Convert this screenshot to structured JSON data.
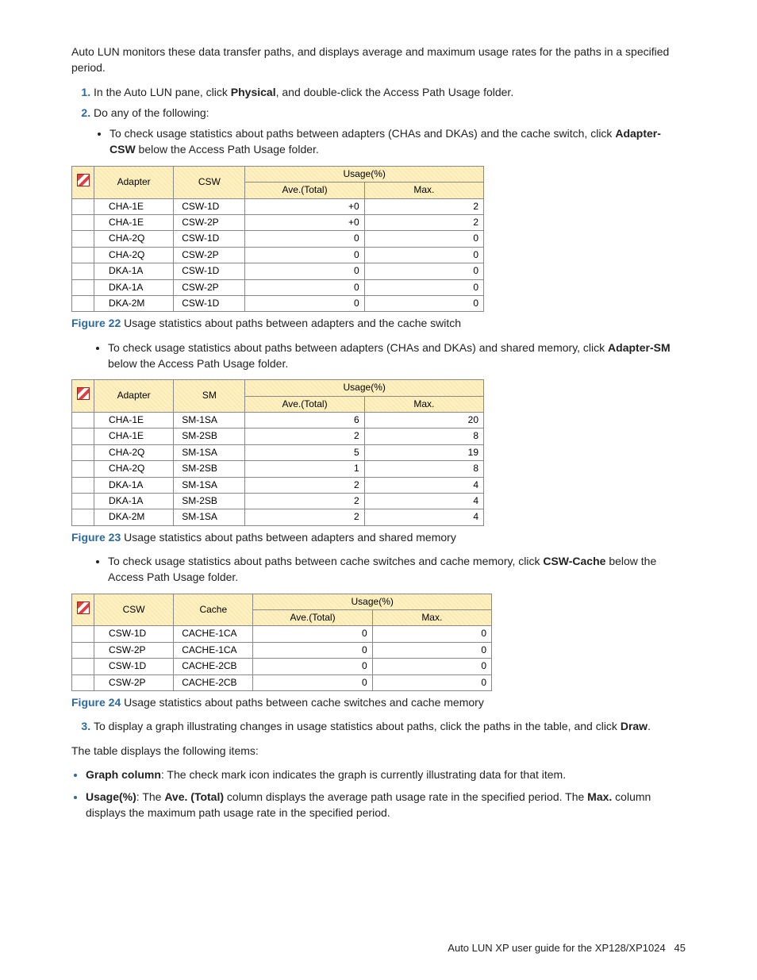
{
  "intro": "Auto LUN monitors these data transfer paths, and displays average and maximum usage rates for the paths in a specified period.",
  "step1_a": "In the Auto LUN pane, click ",
  "step1_b": "Physical",
  "step1_c": ", and double-click the Access Path Usage folder.",
  "step2": "Do any of the following:",
  "bullet1_a": "To check usage statistics about paths between adapters (CHAs and DKAs) and the cache switch, click ",
  "bullet1_b": "Adapter-CSW",
  "bullet1_c": " below the Access Path Usage folder.",
  "bullet2_a": "To check usage statistics about paths between adapters (CHAs and DKAs) and shared memory, click ",
  "bullet2_b": "Adapter-SM",
  "bullet2_c": " below the Access Path Usage folder.",
  "bullet3_a": "To check usage statistics about paths between cache switches and cache memory, click ",
  "bullet3_b": "CSW-Cache",
  "bullet3_c": " below the Access Path Usage folder.",
  "fig22_label": "Figure 22",
  "fig22_text": " Usage statistics about paths between adapters and the cache switch",
  "fig23_label": "Figure 23",
  "fig23_text": " Usage statistics about paths between adapters and shared memory",
  "fig24_label": "Figure 24",
  "fig24_text": " Usage statistics about paths between cache switches and cache memory",
  "step3_a": "To display a graph illustrating changes in usage statistics about paths, click the paths in the table, and click ",
  "step3_b": "Draw",
  "step3_c": ".",
  "closing": "The table displays the following items:",
  "item1_a": "Graph column",
  "item1_b": ": The check mark icon indicates the graph is currently illustrating data for that item.",
  "item2_a": "Usage(%)",
  "item2_b": ": The ",
  "item2_c": "Ave. (Total)",
  "item2_d": " column displays the average path usage rate in the specified period. The ",
  "item2_e": "Max.",
  "item2_f": " column displays the maximum path usage rate in the specified period.",
  "footer_text": "Auto LUN XP user guide for the XP128/XP1024",
  "footer_page": "45",
  "t1": {
    "h1": "Adapter",
    "h2": "CSW",
    "h3": "Usage(%)",
    "h4": "Ave.(Total)",
    "h5": "Max.",
    "rows": [
      {
        "a": "CHA-1E",
        "b": "CSW-1D",
        "c": "+0",
        "d": "2"
      },
      {
        "a": "CHA-1E",
        "b": "CSW-2P",
        "c": "+0",
        "d": "2"
      },
      {
        "a": "CHA-2Q",
        "b": "CSW-1D",
        "c": "0",
        "d": "0"
      },
      {
        "a": "CHA-2Q",
        "b": "CSW-2P",
        "c": "0",
        "d": "0"
      },
      {
        "a": "DKA-1A",
        "b": "CSW-1D",
        "c": "0",
        "d": "0"
      },
      {
        "a": "DKA-1A",
        "b": "CSW-2P",
        "c": "0",
        "d": "0"
      },
      {
        "a": "DKA-2M",
        "b": "CSW-1D",
        "c": "0",
        "d": "0"
      }
    ]
  },
  "t2": {
    "h1": "Adapter",
    "h2": "SM",
    "h3": "Usage(%)",
    "h4": "Ave.(Total)",
    "h5": "Max.",
    "rows": [
      {
        "a": "CHA-1E",
        "b": "SM-1SA",
        "c": "6",
        "d": "20"
      },
      {
        "a": "CHA-1E",
        "b": "SM-2SB",
        "c": "2",
        "d": "8"
      },
      {
        "a": "CHA-2Q",
        "b": "SM-1SA",
        "c": "5",
        "d": "19"
      },
      {
        "a": "CHA-2Q",
        "b": "SM-2SB",
        "c": "1",
        "d": "8"
      },
      {
        "a": "DKA-1A",
        "b": "SM-1SA",
        "c": "2",
        "d": "4"
      },
      {
        "a": "DKA-1A",
        "b": "SM-2SB",
        "c": "2",
        "d": "4"
      },
      {
        "a": "DKA-2M",
        "b": "SM-1SA",
        "c": "2",
        "d": "4"
      }
    ]
  },
  "t3": {
    "h1": "CSW",
    "h2": "Cache",
    "h3": "Usage(%)",
    "h4": "Ave.(Total)",
    "h5": "Max.",
    "rows": [
      {
        "a": "CSW-1D",
        "b": "CACHE-1CA",
        "c": "0",
        "d": "0"
      },
      {
        "a": "CSW-2P",
        "b": "CACHE-1CA",
        "c": "0",
        "d": "0"
      },
      {
        "a": "CSW-1D",
        "b": "CACHE-2CB",
        "c": "0",
        "d": "0"
      },
      {
        "a": "CSW-2P",
        "b": "CACHE-2CB",
        "c": "0",
        "d": "0"
      }
    ]
  }
}
